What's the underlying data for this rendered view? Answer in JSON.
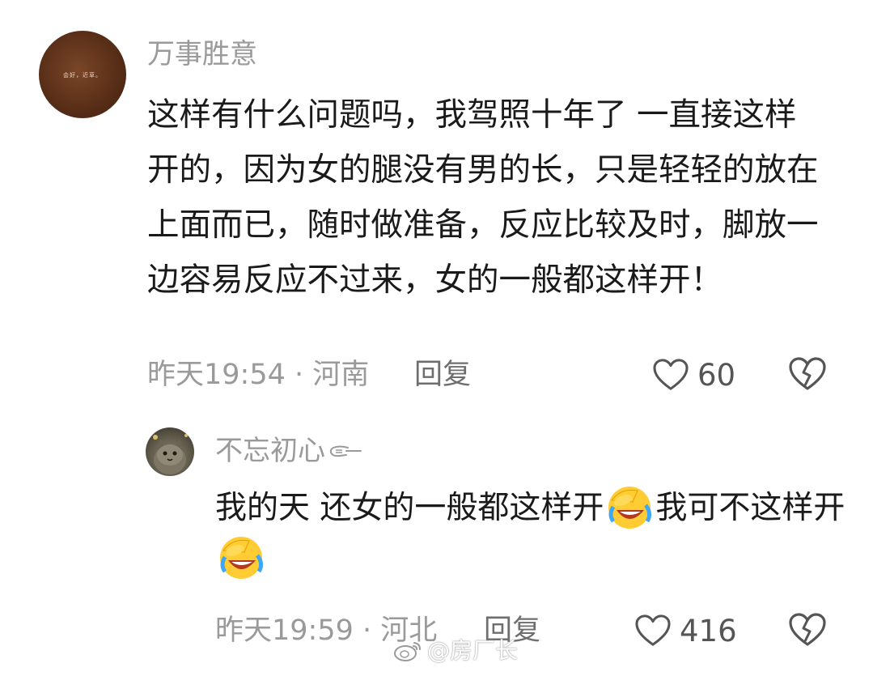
{
  "comment1": {
    "username": "万事胜意",
    "avatar_text": "会好，近草。",
    "content": "这样有什么问题吗，我驾照十年了 一直接这样开的，因为女的腿没有男的长，只是轻轻的放在上面而已，随时做准备，反应比较及时，脚放一边容易反应不过来，女的一般都这样开！",
    "meta": "昨天19:54 · 河南",
    "reply_label": "回复",
    "likes": "60"
  },
  "comment2": {
    "username": "不忘初心",
    "username_icon": "pointing-hand-icon",
    "content_part1": "我的天 还女的一般都这样开",
    "content_part2": "我可不这样开",
    "emoji": "laugh-cry-emoji-icon",
    "meta": "昨天19:59 · 河北",
    "reply_label": "回复",
    "likes": "416"
  },
  "watermark": "@房厂长",
  "colors": {
    "text": "#1a1a1a",
    "secondary": "#9a9a9a",
    "background": "#ffffff"
  }
}
